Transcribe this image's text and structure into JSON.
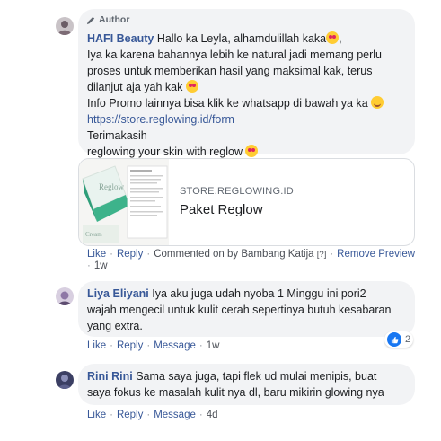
{
  "colors": {
    "link": "#385898",
    "bubble": "#f2f3f5",
    "like": "#1877f2"
  },
  "comments": [
    {
      "badge": "Author",
      "author": "HAFI Beauty",
      "lines": [
        "Hallo ka Leyla, alhamdulillah kaka",
        "Iya ka karena bahannya lebih ke natural jadi memang perlu",
        "proses untuk memberikan hasil yang maksimal kak, terus",
        "dilanjut aja yah kak",
        "Info Promo lainnya bisa klik ke whatsapp di bawah ya ka",
        "https://store.reglowing.id/form",
        "Terimakasih",
        "reglowing your skin with reglow"
      ],
      "link_preview": {
        "domain": "STORE.REGLOWING.ID",
        "title": "Paket Reglow"
      },
      "actions": {
        "like": "Like",
        "reply": "Reply",
        "commented_on": "Commented on by Bambang Katija",
        "help": "[?]",
        "remove_preview": "Remove Preview",
        "time": "1w"
      }
    },
    {
      "author": "Liya Eliyani",
      "lines": [
        "Iya aku juga udah nyoba 1 Minggu ini pori2",
        "wajah mengecil untuk kulit cerah sepertinya butuh kesabaran",
        "yang extra."
      ],
      "actions": {
        "like": "Like",
        "reply": "Reply",
        "message": "Message",
        "time": "1w"
      },
      "reaction_count": "2"
    },
    {
      "author": "Rini Rini",
      "lines": [
        "Sama saya juga, tapi flek ud mulai menipis, buat",
        "saya fokus ke masalah kulit nya dl, baru mikirin glowing nya"
      ],
      "actions": {
        "like": "Like",
        "reply": "Reply",
        "message": "Message",
        "time": "4d"
      }
    }
  ]
}
